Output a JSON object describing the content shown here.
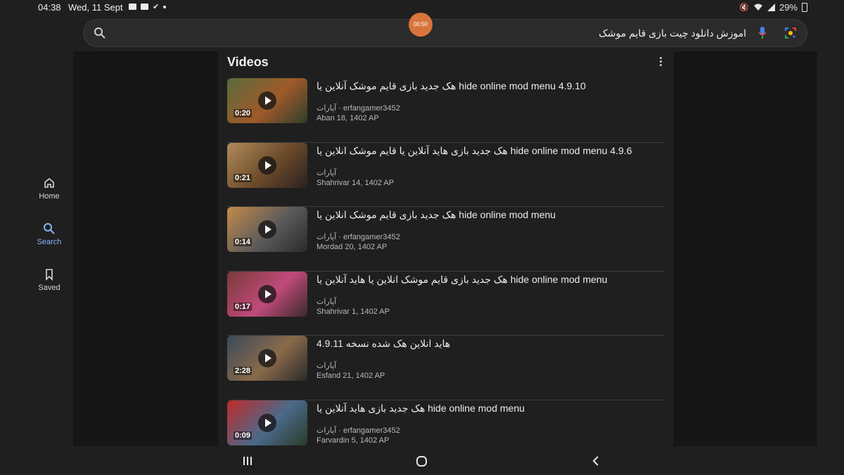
{
  "status": {
    "time": "04:38",
    "date": "Wed, 11 Sept",
    "battery": "29%"
  },
  "search": {
    "query": "اموزش دانلود چیت بازی قایم موشک",
    "recording_badge": "00:50"
  },
  "nav_rail": [
    {
      "label": "Home",
      "icon": "home-icon"
    },
    {
      "label": "Search",
      "icon": "search-icon",
      "active": true
    },
    {
      "label": "Saved",
      "icon": "bookmark-icon"
    }
  ],
  "section": {
    "title": "Videos"
  },
  "videos": [
    {
      "title": "هک جدید بازی قایم موشک آنلاین یا hide online mod menu 4.9.10",
      "source": "آپارات · erfangamer3452",
      "date": "Aban 18, 1402 AP",
      "duration": "0:20",
      "thumb_colors": [
        "#5a6a3c",
        "#a05a2a",
        "#2d3e2a"
      ]
    },
    {
      "title": "هک جدید بازی هاید آنلاین یا قایم موشک انلاین یا hide online mod menu 4.9.6",
      "source": "آپارات",
      "date": "Shahrivar 14, 1402 AP",
      "duration": "0:21",
      "thumb_colors": [
        "#b08a5a",
        "#6a4a2a",
        "#2a2220"
      ]
    },
    {
      "title": "هک جدید بازی قایم موشک انلاین یا hide online mod menu",
      "source": "آپارات · erfangamer3452",
      "date": "Mordad 20, 1402 AP",
      "duration": "0:14",
      "thumb_colors": [
        "#c48a4a",
        "#5a5a5a",
        "#2a2a2a"
      ]
    },
    {
      "title": "هک جدید بازی قایم موشک انلاین یا هاید آنلاین یا hide online mod menu",
      "source": "آپارات",
      "date": "Shahrivar 1, 1402 AP",
      "duration": "0:17",
      "thumb_colors": [
        "#7a3a3a",
        "#c04a7a",
        "#3a2a2a"
      ]
    },
    {
      "title": "هاید انلاین هک شده نسخه 4.9.11",
      "source": "آپارات",
      "date": "Esfand 21, 1402 AP",
      "duration": "2:28",
      "thumb_colors": [
        "#3a4a5a",
        "#8a6a4a",
        "#2a2a2a"
      ]
    },
    {
      "title": "هک جدید بازی هاید آنلاین یا hide online mod menu",
      "source": "آپارات · erfangamer3452",
      "date": "Farvardin 5, 1402 AP",
      "duration": "0:09",
      "thumb_colors": [
        "#c02a2a",
        "#4a6a8a",
        "#2a3a2a"
      ]
    }
  ],
  "colors": {
    "accent": "#8ab4f8",
    "record": "#d9753b",
    "background": "#1f1f1f"
  }
}
